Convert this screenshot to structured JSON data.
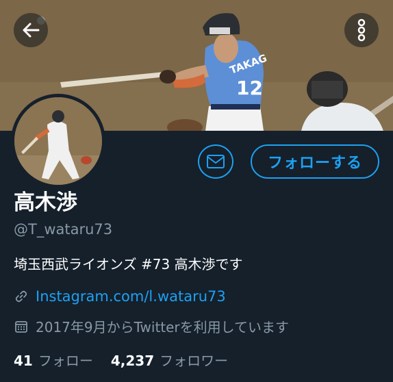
{
  "header": {
    "back_icon": "arrow-left-icon",
    "more_icon": "more-vertical-icon"
  },
  "profile": {
    "display_name": "高木渉",
    "handle": "@T_wataru73",
    "bio": "埼玉西武ライオンズ #73 高木渉です",
    "link": "Instagram.com/l.wataru73",
    "joined": "2017年9月からTwitterを利用しています",
    "jersey_name": "TAKAG",
    "jersey_number": "12"
  },
  "actions": {
    "follow_label": "フォローする",
    "message_icon": "mail-icon"
  },
  "stats": {
    "following_count": "41",
    "following_label": "フォロー",
    "followers_count": "4,237",
    "followers_label": "フォロワー"
  },
  "colors": {
    "background": "#15202b",
    "accent": "#1da1f2",
    "secondary_text": "#8899a6"
  }
}
